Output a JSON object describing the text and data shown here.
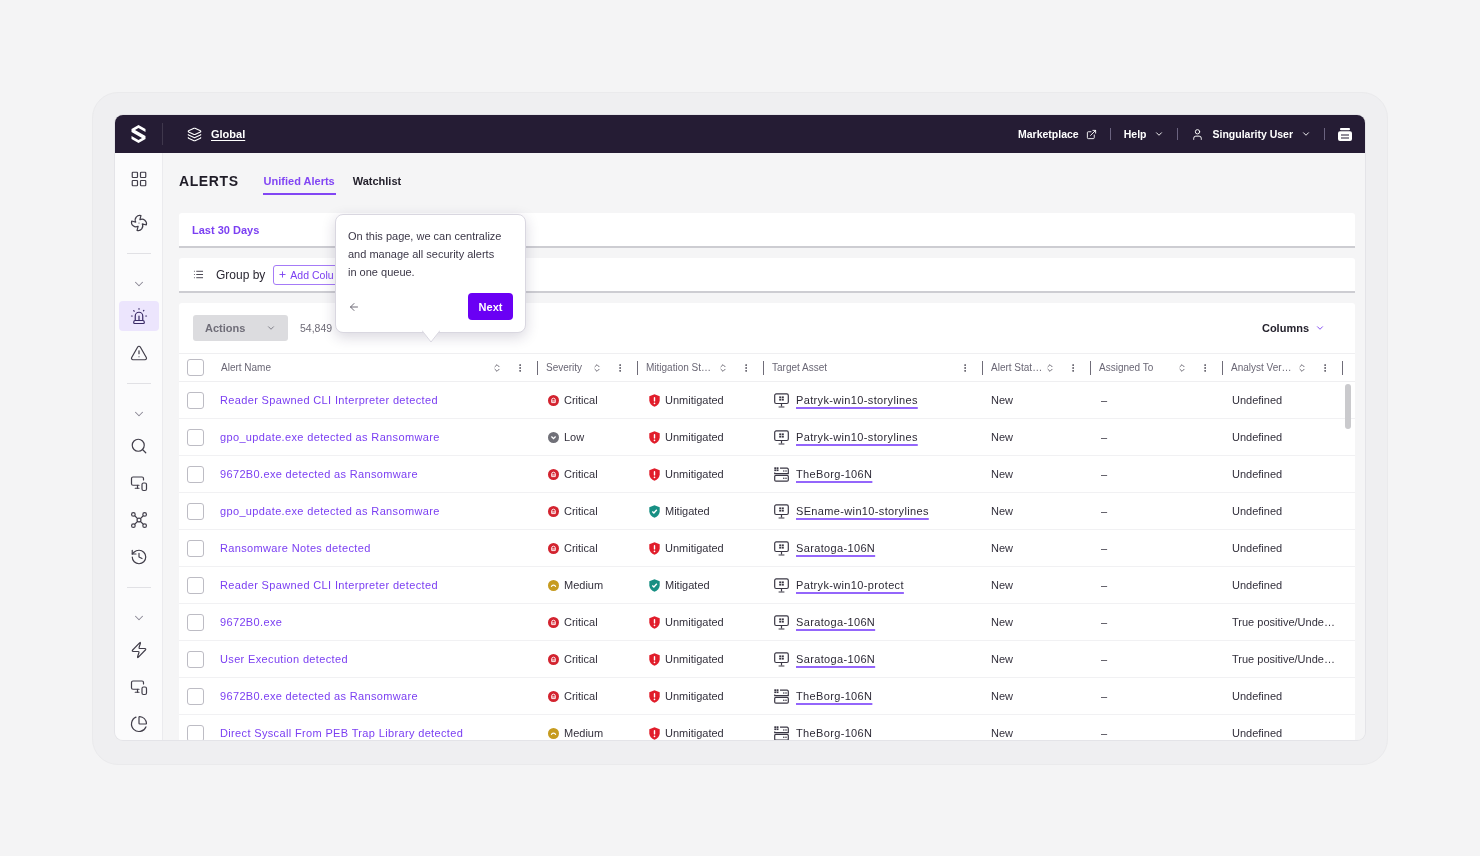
{
  "top_bar": {
    "scope_link": "Global",
    "links": [
      {
        "label": "Marketplace",
        "kind": "external"
      },
      {
        "label": "Help",
        "kind": "menu"
      }
    ],
    "user_menu": "Singularity User"
  },
  "sidebar": {
    "groups": [
      {
        "items": [
          {
            "selected": false
          },
          {
            "selected": false
          }
        ]
      },
      {
        "items": [
          {
            "selected": true
          },
          {
            "selected": false
          }
        ]
      },
      {
        "items": [
          {
            "selected": false
          },
          {
            "selected": false
          },
          {
            "selected": false
          },
          {
            "selected": false
          }
        ]
      },
      {
        "items": [
          {
            "selected": false
          },
          {
            "selected": false
          },
          {
            "selected": false
          }
        ]
      }
    ]
  },
  "page": {
    "title": "ALERTS",
    "tabs": [
      {
        "label": "Unified Alerts",
        "selected": true
      },
      {
        "label": "Watchlist",
        "selected": false
      }
    ]
  },
  "filter_bar": {
    "date_range": "Last 30 Days"
  },
  "group_bar": {
    "label": "Group by",
    "add_button": "Add Colu"
  },
  "table_toolbar": {
    "actions_button": {
      "label": "Actions",
      "disabled": true
    },
    "count": "54,849",
    "columns_button": "Columns"
  },
  "table": {
    "select_all": {
      "checked": false
    },
    "columns": [
      {
        "label": "Alert Name",
        "sortable": true
      },
      {
        "label": "Severity",
        "sortable": true
      },
      {
        "label": "Mitigation St…",
        "sortable": true
      },
      {
        "label": "Target Asset",
        "sortable": false
      },
      {
        "label": "Alert Stat…",
        "sortable": true
      },
      {
        "label": "Assigned To",
        "sortable": true
      },
      {
        "label": "Analyst Ver…",
        "sortable": true
      }
    ],
    "rows": [
      {
        "checked": false,
        "alert_name": "Reader Spawned CLI Interpreter detected",
        "severity": {
          "label": "Critical",
          "kind": "critical"
        },
        "mitigation": {
          "label": "Unmitigated",
          "kind": "unmitigated"
        },
        "target_asset": {
          "name": "Patryk-win10-storylines",
          "kind": "workstation"
        },
        "alert_status": "New",
        "assigned_to": "–",
        "analyst_verdict": "Undefined"
      },
      {
        "checked": false,
        "alert_name": "gpo_update.exe detected as Ransomware",
        "severity": {
          "label": "Low",
          "kind": "low"
        },
        "mitigation": {
          "label": "Unmitigated",
          "kind": "unmitigated"
        },
        "target_asset": {
          "name": "Patryk-win10-storylines",
          "kind": "workstation"
        },
        "alert_status": "New",
        "assigned_to": "–",
        "analyst_verdict": "Undefined"
      },
      {
        "checked": false,
        "alert_name": "9672B0.exe detected as Ransomware",
        "severity": {
          "label": "Critical",
          "kind": "critical"
        },
        "mitigation": {
          "label": "Unmitigated",
          "kind": "unmitigated"
        },
        "target_asset": {
          "name": "TheBorg-106N",
          "kind": "server"
        },
        "alert_status": "New",
        "assigned_to": "–",
        "analyst_verdict": "Undefined"
      },
      {
        "checked": false,
        "alert_name": "gpo_update.exe detected as Ransomware",
        "severity": {
          "label": "Critical",
          "kind": "critical"
        },
        "mitigation": {
          "label": "Mitigated",
          "kind": "mitigated"
        },
        "target_asset": {
          "name": "SEname-win10-storylines",
          "kind": "workstation"
        },
        "alert_status": "New",
        "assigned_to": "–",
        "analyst_verdict": "Undefined"
      },
      {
        "checked": false,
        "alert_name": "Ransomware Notes detected",
        "severity": {
          "label": "Critical",
          "kind": "critical"
        },
        "mitigation": {
          "label": "Unmitigated",
          "kind": "unmitigated"
        },
        "target_asset": {
          "name": "Saratoga-106N",
          "kind": "workstation"
        },
        "alert_status": "New",
        "assigned_to": "–",
        "analyst_verdict": "Undefined"
      },
      {
        "checked": false,
        "alert_name": "Reader Spawned CLI Interpreter detected",
        "severity": {
          "label": "Medium",
          "kind": "medium"
        },
        "mitigation": {
          "label": "Mitigated",
          "kind": "mitigated"
        },
        "target_asset": {
          "name": "Patryk-win10-protect",
          "kind": "workstation"
        },
        "alert_status": "New",
        "assigned_to": "–",
        "analyst_verdict": "Undefined"
      },
      {
        "checked": false,
        "alert_name": "9672B0.exe",
        "severity": {
          "label": "Critical",
          "kind": "critical"
        },
        "mitigation": {
          "label": "Unmitigated",
          "kind": "unmitigated"
        },
        "target_asset": {
          "name": "Saratoga-106N",
          "kind": "workstation"
        },
        "alert_status": "New",
        "assigned_to": "–",
        "analyst_verdict": "True positive/Unde…"
      },
      {
        "checked": false,
        "alert_name": "User Execution detected",
        "severity": {
          "label": "Critical",
          "kind": "critical"
        },
        "mitigation": {
          "label": "Unmitigated",
          "kind": "unmitigated"
        },
        "target_asset": {
          "name": "Saratoga-106N",
          "kind": "workstation"
        },
        "alert_status": "New",
        "assigned_to": "–",
        "analyst_verdict": "True positive/Unde…"
      },
      {
        "checked": false,
        "alert_name": "9672B0.exe detected as Ransomware",
        "severity": {
          "label": "Critical",
          "kind": "critical"
        },
        "mitigation": {
          "label": "Unmitigated",
          "kind": "unmitigated"
        },
        "target_asset": {
          "name": "TheBorg-106N",
          "kind": "server"
        },
        "alert_status": "New",
        "assigned_to": "–",
        "analyst_verdict": "Undefined"
      },
      {
        "checked": false,
        "alert_name": "Direct Syscall From PEB Trap Library detected",
        "severity": {
          "label": "Medium",
          "kind": "medium"
        },
        "mitigation": {
          "label": "Unmitigated",
          "kind": "unmitigated"
        },
        "target_asset": {
          "name": "TheBorg-106N",
          "kind": "server"
        },
        "alert_status": "New",
        "assigned_to": "–",
        "analyst_verdict": "Undefined"
      }
    ]
  },
  "tooltip": {
    "text": "On this page, we can centralize and manage all security alerts in one queue.",
    "next_button": "Next"
  }
}
